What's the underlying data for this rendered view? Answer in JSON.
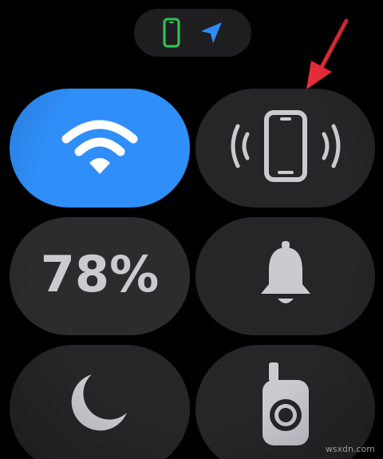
{
  "status_bar": {
    "icons": [
      "iphone-connected-icon",
      "location-arrow-icon"
    ],
    "connected_color": "#34c759",
    "location_color": "#2f8ef8"
  },
  "tiles": {
    "wifi": {
      "icon": "wifi-icon",
      "state": "on",
      "color": "#2f8ef8"
    },
    "ping_iphone": {
      "icon": "ping-iphone-icon",
      "state": "off"
    },
    "battery": {
      "label": "78%"
    },
    "silent_mode": {
      "icon": "bell-icon",
      "state": "off"
    },
    "do_not_disturb": {
      "icon": "moon-icon",
      "state": "off"
    },
    "walkie_talkie": {
      "icon": "walkie-talkie-icon",
      "state": "off"
    }
  },
  "annotation": {
    "icon": "red-arrow-icon",
    "color": "#ee2d3a"
  },
  "watermark": {
    "text": "wsxdn.com"
  }
}
